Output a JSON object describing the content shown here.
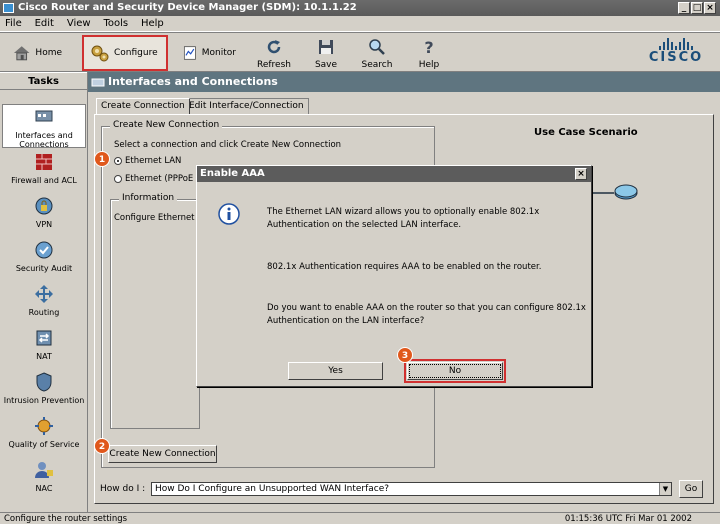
{
  "window": {
    "title": "Cisco Router and Security Device Manager (SDM): 10.1.1.22"
  },
  "menu": [
    "File",
    "Edit",
    "View",
    "Tools",
    "Help"
  ],
  "toolbar": {
    "home": "Home",
    "configure": "Configure",
    "monitor": "Monitor",
    "refresh": "Refresh",
    "save": "Save",
    "search": "Search",
    "help": "Help",
    "brand": "CISCO"
  },
  "tasks": {
    "header": "Tasks",
    "items": [
      {
        "label1": "Interfaces and",
        "label2": "Connections"
      },
      {
        "label1": "Firewall and ACL",
        "label2": ""
      },
      {
        "label1": "VPN",
        "label2": ""
      },
      {
        "label1": "Security Audit",
        "label2": ""
      },
      {
        "label1": "Routing",
        "label2": ""
      },
      {
        "label1": "NAT",
        "label2": ""
      },
      {
        "label1": "Intrusion Prevention",
        "label2": ""
      },
      {
        "label1": "Quality of Service",
        "label2": ""
      },
      {
        "label1": "NAC",
        "label2": ""
      }
    ]
  },
  "panel": {
    "title": "Interfaces and Connections",
    "tabs": [
      "Create Connection",
      "Edit Interface/Connection"
    ],
    "group_label": "Create New Connection",
    "instruction": "Select a connection and click Create New Connection",
    "radio_ethernet": "Ethernet LAN",
    "radio_pppoe": "Ethernet (PPPoE or",
    "info_label": "Information",
    "info_text": "Configure Ethernet LA",
    "create_button": "Create New Connection",
    "use_case": "Use Case Scenario",
    "howdoi_label": "How do I :",
    "howdoi_value": "How Do I Configure an Unsupported WAN Interface?",
    "go_button": "Go"
  },
  "dialog": {
    "title": "Enable AAA",
    "line1": "The Ethernet LAN wizard allows you to optionally enable 802.1x Authentication on the selected LAN interface.",
    "line2": "802.1x Authentication requires AAA to be enabled on the router.",
    "line3": "Do you want to enable AAA on the router so that you can configure 802.1x Authentication on the LAN interface?",
    "yes": "Yes",
    "no": "No"
  },
  "badges": [
    "1",
    "2",
    "3"
  ],
  "status": {
    "left": "Configure the router settings",
    "right": "01:15:36 UTC Fri Mar 01 2002"
  },
  "colors": {
    "accent": "#e0581c",
    "header": "#5f7580",
    "brand": "#1b4e7a"
  }
}
